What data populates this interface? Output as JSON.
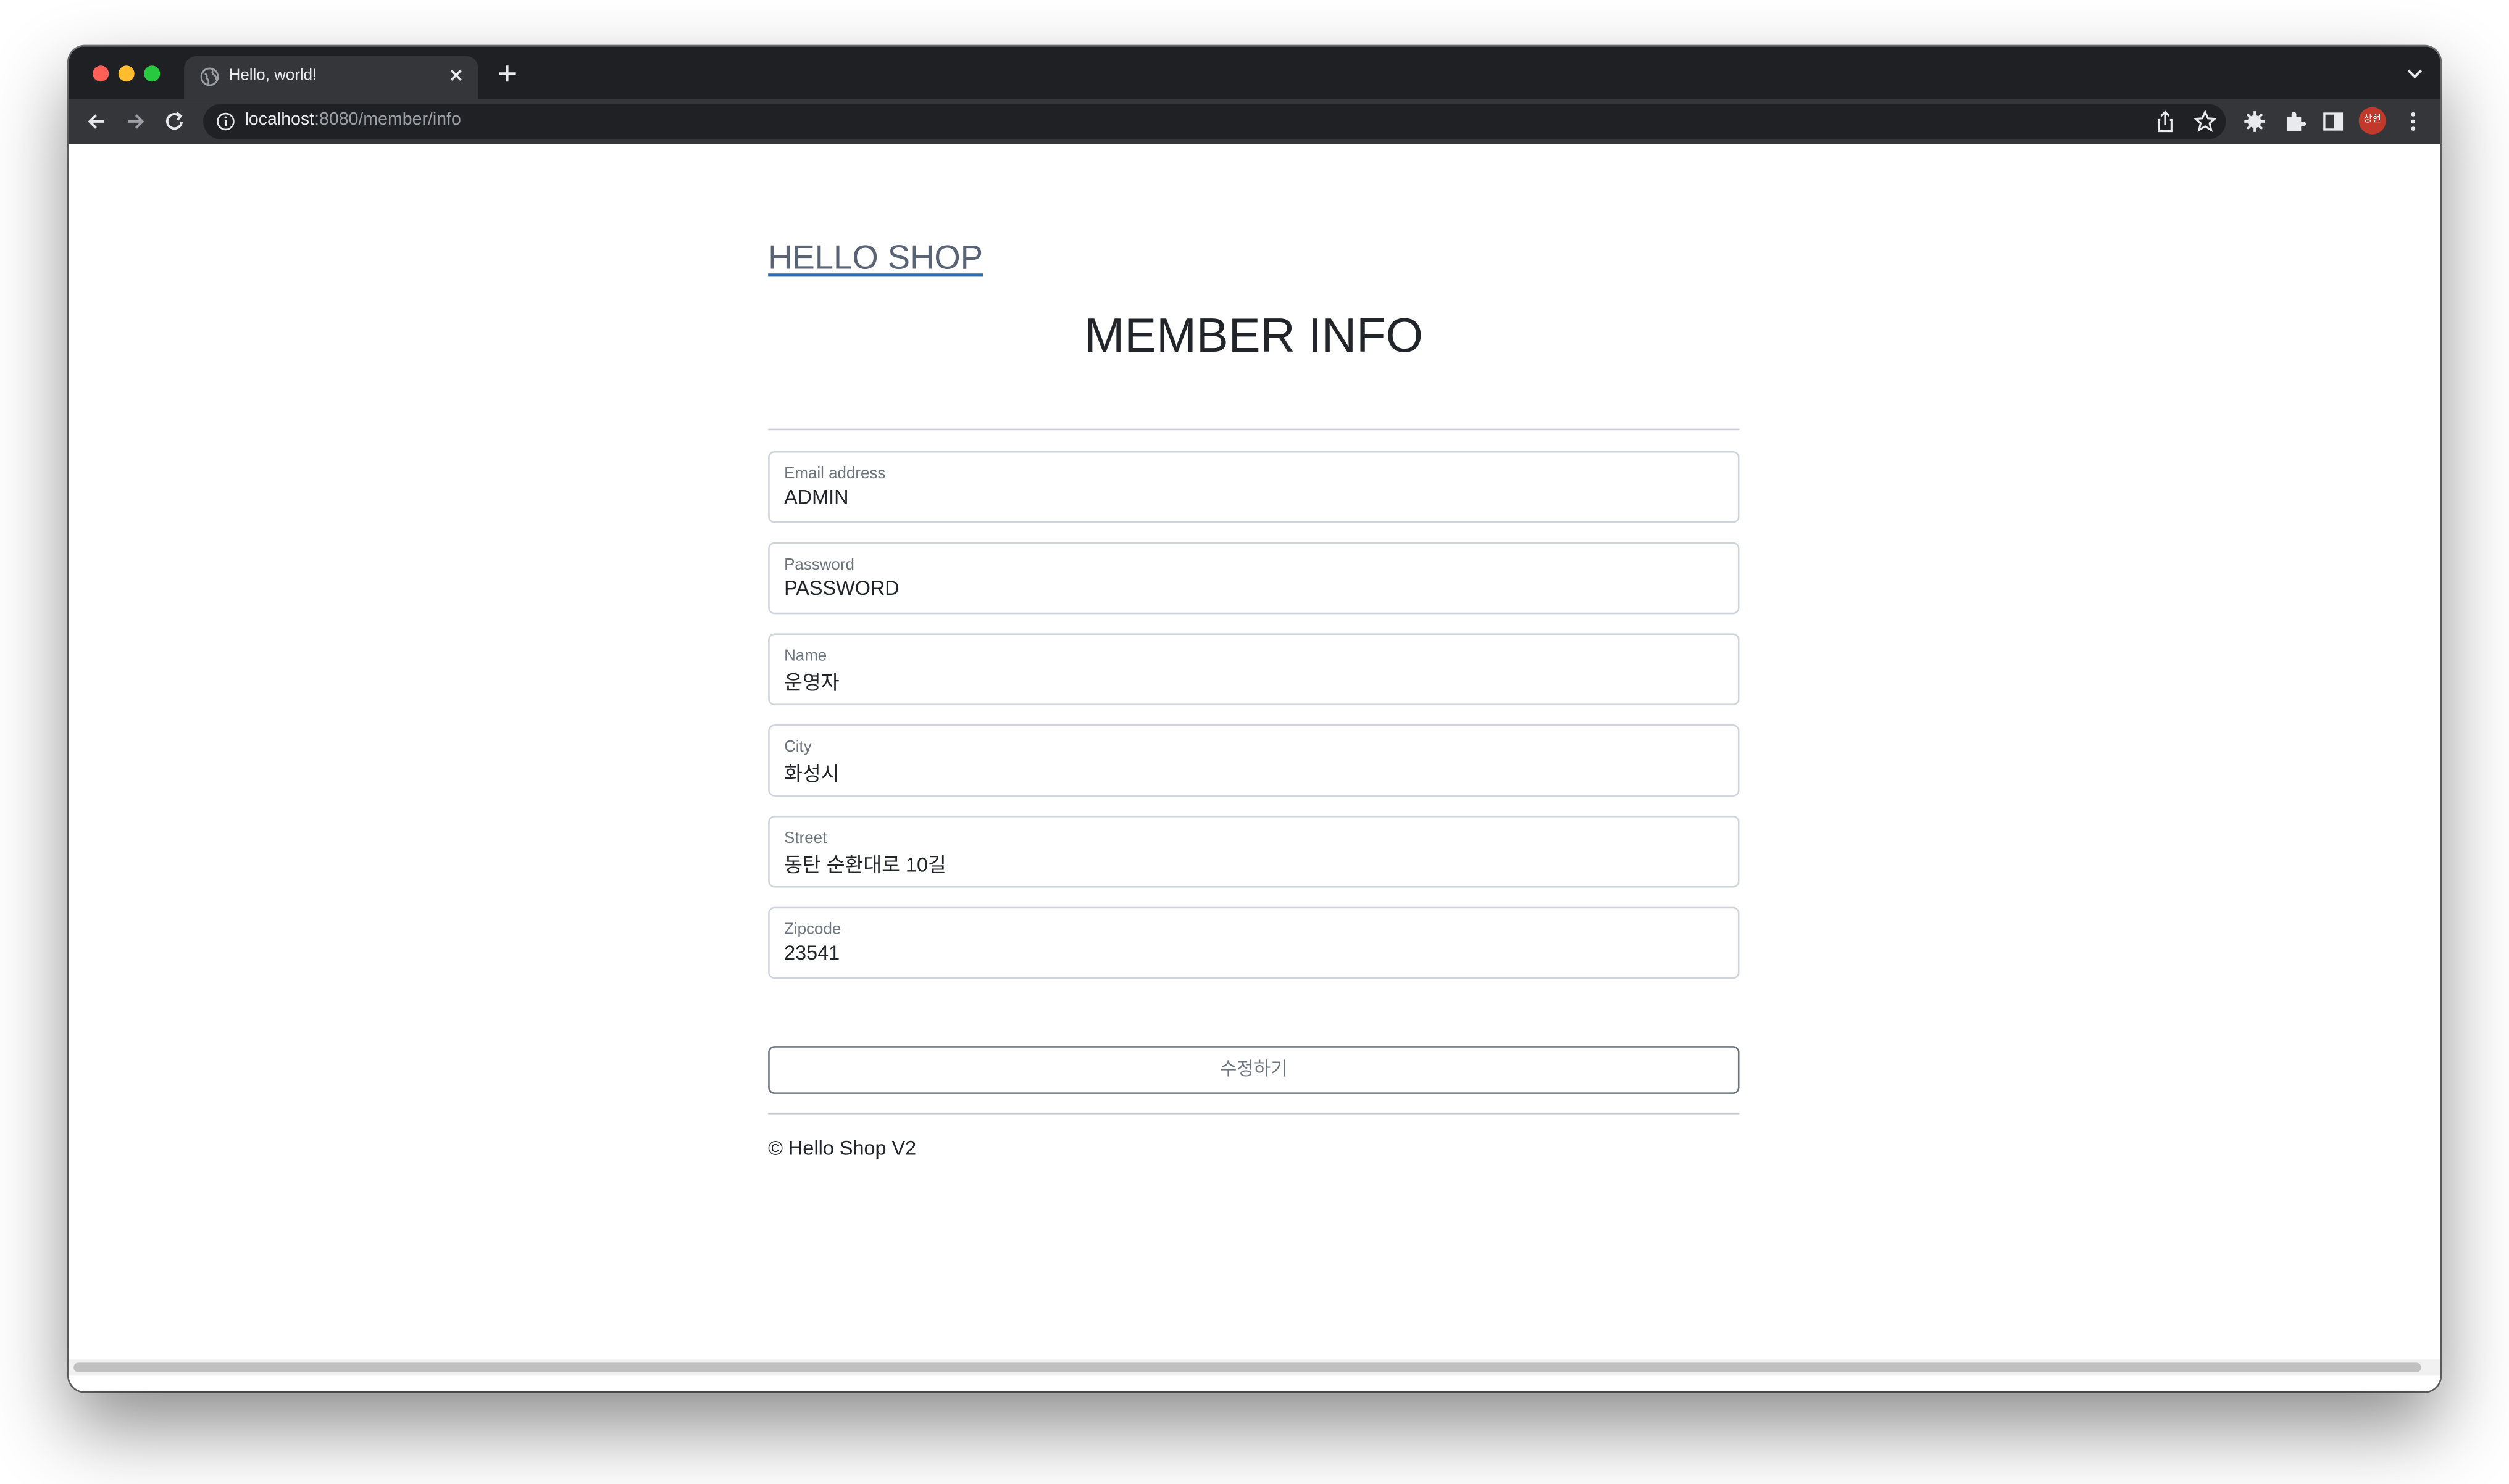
{
  "browser": {
    "tab_title": "Hello, world!",
    "url_host": "localhost",
    "url_path": ":8080/member/info",
    "profile_initials": "상현",
    "colors": {
      "tabbar_bg": "#1f2023",
      "toolbar_bg": "#35363a",
      "close_red": "#fe5f57",
      "minimize_yellow": "#febc2e",
      "zoom_green": "#28c840",
      "profile_bg": "#c0392b"
    },
    "icons": [
      "globe-icon",
      "close-icon",
      "plus-icon",
      "chevron-down-icon",
      "back-arrow-icon",
      "forward-arrow-icon",
      "reload-icon",
      "info-icon",
      "share-icon",
      "star-icon",
      "extension-gear-icon",
      "puzzle-icon",
      "side-panel-icon",
      "more-vertical-icon"
    ]
  },
  "page": {
    "brand": "HELLO SHOP",
    "title": "MEMBER INFO",
    "fields": [
      {
        "label": "Email address",
        "value": "ADMIN"
      },
      {
        "label": "Password",
        "value": "PASSWORD"
      },
      {
        "label": "Name",
        "value": "운영자"
      },
      {
        "label": "City",
        "value": "화성시"
      },
      {
        "label": "Street",
        "value": "동탄 순환대로 10길"
      },
      {
        "label": "Zipcode",
        "value": "23541"
      }
    ],
    "submit_label": "수정하기",
    "footer": "© Hello Shop V2",
    "colors": {
      "brand_link": "#5a6475",
      "brand_underline": "#2b6cb0",
      "text": "#212529",
      "label": "#6c757d",
      "border": "#ced4da"
    }
  }
}
